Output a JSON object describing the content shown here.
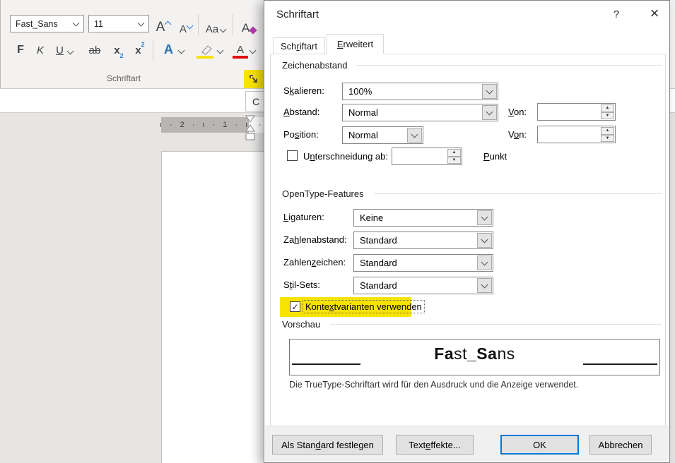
{
  "colors": {
    "highlight_yellow": "#f7e300",
    "accent_blue": "#0078d7",
    "font_color_red": "#e01010",
    "text_effects_blue": "#2e75b5",
    "clear_format_purple": "#b23ab2"
  },
  "icons": {
    "checkmark": "✓",
    "spin_up": "▲",
    "spin_down": "▼",
    "help": "?",
    "close": "×",
    "dot": "·"
  },
  "ribbon": {
    "font_name": "Fast_Sans",
    "font_size": "11",
    "group_label": "Schriftart",
    "buttons": {
      "grow_font": "A",
      "shrink_font": "A",
      "change_case": "Aa",
      "clear_formatting": "A",
      "bold": "F",
      "italic": "K",
      "underline": "U",
      "strikethrough": "ab",
      "subscript_base": "x",
      "subscript_num": "2",
      "superscript_base": "x",
      "superscript_num": "2",
      "text_effects": "A",
      "font_color": "A"
    }
  },
  "document": {
    "corner_text": "C",
    "ruler_marks_margin": "ı · 2 · ı · 1 · ı",
    "ruler_marks_text": "· ı"
  },
  "dialog": {
    "title": "Schriftart",
    "tabs": {
      "schriftart": {
        "pre": "Sch",
        "key": "r",
        "post": "iftart"
      },
      "erweitert": {
        "pre": "",
        "key": "E",
        "post": "rweitert"
      }
    },
    "sections": {
      "zeichenabstand": "Zeichenabstand",
      "opentype": "OpenType-Features",
      "vorschau": "Vorschau"
    },
    "labels": {
      "skalieren": {
        "pre": "S",
        "key": "k",
        "post": "alieren:"
      },
      "abstand": {
        "pre": "",
        "key": "A",
        "post": "bstand:"
      },
      "position": {
        "pre": "Po",
        "key": "s",
        "post": "ition:"
      },
      "von1": {
        "pre": "",
        "key": "V",
        "post": "on:"
      },
      "von2": {
        "pre": "V",
        "key": "o",
        "post": "n:"
      },
      "unterschneidung": {
        "pre": "U",
        "key": "n",
        "post": "terschneidung ab:"
      },
      "punkt": {
        "pre": "",
        "key": "P",
        "post": "unkt"
      },
      "ligaturen": {
        "pre": "",
        "key": "L",
        "post": "igaturen:"
      },
      "zahlenabstand": {
        "pre": "Za",
        "key": "h",
        "post": "lenabstand:"
      },
      "zahlenzeichen": {
        "pre": "Zahlen",
        "key": "z",
        "post": "eichen:"
      },
      "stilsets": {
        "pre": "S",
        "key": "t",
        "post": "il-Sets:"
      },
      "kontextvarianten": {
        "pre": "Konte",
        "key": "x",
        "post": "tvarianten verwenden"
      }
    },
    "values": {
      "skalieren": "100%",
      "abstand": "Normal",
      "position": "Normal",
      "von1": "",
      "von2": "",
      "unterschneidung_ab": "",
      "ligaturen": "Keine",
      "zahlenabstand": "Standard",
      "zahlenzeichen": "Standard",
      "stilsets": "Standard"
    },
    "preview": {
      "part1_bold": "Fa",
      "part2": "st",
      "part3_bold": "_Sa",
      "part4": "ns",
      "caption": "Die TrueType-Schriftart wird für den Ausdruck und die Anzeige verwendet."
    },
    "buttons": {
      "als_standard": {
        "pre": "Als Stan",
        "key": "d",
        "post": "ard festlegen"
      },
      "texteffekte": {
        "pre": "Text",
        "key": "e",
        "post": "ffekte..."
      },
      "ok": "OK",
      "abbrechen": "Abbrechen"
    }
  }
}
